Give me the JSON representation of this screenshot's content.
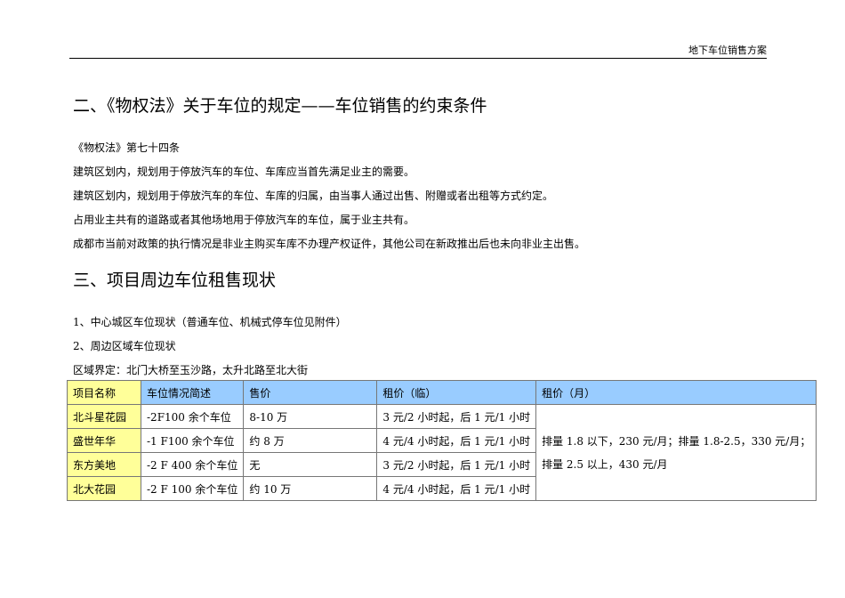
{
  "header": "地下车位销售方案",
  "section2": {
    "title": "二、《物权法》关于车位的规定——车位销售的约束条件",
    "paragraphs": [
      "《物权法》第七十四条",
      "建筑区划内，规划用于停放汽车的车位、车库应当首先满足业主的需要。",
      "建筑区划内，规划用于停放汽车的车位、车库的归属，由当事人通过出售、附赠或者出租等方式约定。",
      "占用业主共有的道路或者其他场地用于停放汽车的车位，属于业主共有。",
      "成都市当前对政策的执行情况是非业主购买车库不办理产权证件，其他公司在新政推出后也未向非业主出售。"
    ]
  },
  "section3": {
    "title": "三、项目周边车位租售现状",
    "paragraphs": [
      "1、中心城区车位现状（普通车位、机械式停车位见附件）",
      "2、周边区域车位现状",
      "区域界定：北门大桥至玉沙路，太升北路至北大街"
    ]
  },
  "table": {
    "headers": [
      "项目名称",
      "车位情况简述",
      "售价",
      "租价（临）",
      "租价（月）"
    ],
    "rows": [
      [
        "北斗星花园",
        "-2F100 余个车位",
        "8-10 万",
        "3 元/2 小时起，后 1 元/1 小时"
      ],
      [
        "盛世年华",
        "-1 F100 余个车位",
        "约 8 万",
        "4 元/4 小时起，后 1 元/1 小时"
      ],
      [
        "东方美地",
        "-2 F 400 余个车位",
        "无",
        "3 元/2 小时起，后 1 元/1 小时"
      ],
      [
        "北大花园",
        "-2 F 100 余个车位",
        "约 10 万",
        "4 元/4 小时起，后 1 元/1 小时"
      ]
    ],
    "monthly": [
      "排量 1.8 以下，230 元/月；排量 1.8-2.5，330 元/月；",
      "排量 2.5 以上，430 元/月"
    ]
  }
}
